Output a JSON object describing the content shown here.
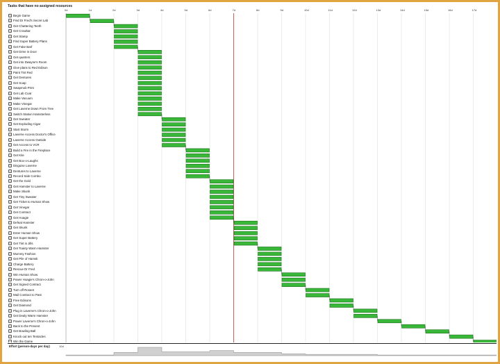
{
  "header": {
    "title": "Tasks that have no assigned resources"
  },
  "axis": {
    "day_labels": [
      "0d",
      "1d",
      "2d",
      "3d",
      "4d",
      "5d",
      "6d",
      "7d",
      "8d",
      "9d",
      "10d",
      "11d",
      "12d",
      "13d",
      "14d",
      "15d",
      "16d",
      "17d"
    ]
  },
  "effort": {
    "label": "Effort (person-days per day)",
    "max_label": "10d"
  },
  "colors": {
    "bar_fill": "#39b739",
    "bar_stroke": "#1c6f1c",
    "today_line": "#c0383c",
    "grid": "#d7e3d0",
    "frame": "#e0a440"
  },
  "today_day": 7,
  "tasks": [
    {
      "name": "Begin Game",
      "start": 0,
      "dur": 1
    },
    {
      "name": "Find Dr Fred's Secret Lab",
      "start": 1,
      "dur": 1
    },
    {
      "name": "Get Chattering Teeth",
      "start": 2,
      "dur": 1
    },
    {
      "name": "Get Crowbar",
      "start": 2,
      "dur": 1
    },
    {
      "name": "Get Stamp",
      "start": 2,
      "dur": 1
    },
    {
      "name": "Find Super Battery Plans",
      "start": 2,
      "dur": 1
    },
    {
      "name": "Get Fake Barf",
      "start": 2,
      "dur": 1
    },
    {
      "name": "Get Dime in Door",
      "start": 3,
      "dur": 1
    },
    {
      "name": "Get quarters",
      "start": 3,
      "dur": 1
    },
    {
      "name": "Get into Dwayne's Room",
      "start": 3,
      "dur": 1
    },
    {
      "name": "Give plans to Red Edison",
      "start": 3,
      "dur": 1
    },
    {
      "name": "Paint Tint Red",
      "start": 3,
      "dur": 1
    },
    {
      "name": "Get Dentures",
      "start": 3,
      "dur": 1
    },
    {
      "name": "Get Soap",
      "start": 3,
      "dur": 1
    },
    {
      "name": "Swapmob Print",
      "start": 3,
      "dur": 1
    },
    {
      "name": "Get Lab Coat",
      "start": 3,
      "dur": 1
    },
    {
      "name": "Make Vacuum",
      "start": 3,
      "dur": 1
    },
    {
      "name": "Make Vinegar",
      "start": 3,
      "dur": 1
    },
    {
      "name": "Get Laverne Down From Tree",
      "start": 3,
      "dur": 1
    },
    {
      "name": "Switch Station Hamsterless",
      "start": 3,
      "dur": 1
    },
    {
      "name": "Get Sweater",
      "start": 4,
      "dur": 1
    },
    {
      "name": "Get Exploding Cigar",
      "start": 4,
      "dur": 1
    },
    {
      "name": "Start Storm",
      "start": 4,
      "dur": 1
    },
    {
      "name": "Laverne Access Doctor's Office",
      "start": 4,
      "dur": 1
    },
    {
      "name": "Laverne Access Outside",
      "start": 4,
      "dur": 1
    },
    {
      "name": "Get Access to VCR",
      "start": 4,
      "dur": 1
    },
    {
      "name": "Build a Fire in the Fireplace",
      "start": 5,
      "dur": 1
    },
    {
      "name": "Get Kite",
      "start": 5,
      "dur": 1
    },
    {
      "name": "Get Box-o-Laughs",
      "start": 5,
      "dur": 1
    },
    {
      "name": "Disguise Laverne",
      "start": 5,
      "dur": 1
    },
    {
      "name": "Dentures to Laverne",
      "start": 5,
      "dur": 1
    },
    {
      "name": "Record Sale Combo",
      "start": 5,
      "dur": 1
    },
    {
      "name": "Get the Gold",
      "start": 6,
      "dur": 1
    },
    {
      "name": "Get Hamster to Laverne",
      "start": 6,
      "dur": 1
    },
    {
      "name": "Make Skunk",
      "start": 6,
      "dur": 1
    },
    {
      "name": "Get Tiny Sweater",
      "start": 6,
      "dur": 1
    },
    {
      "name": "Get Ticket to Human Show",
      "start": 6,
      "dur": 1
    },
    {
      "name": "Get Vinegar",
      "start": 6,
      "dur": 1
    },
    {
      "name": "Get Contract",
      "start": 6,
      "dur": 1
    },
    {
      "name": "Get Hoagie",
      "start": 6,
      "dur": 1
    },
    {
      "name": "Defeat Hamster",
      "start": 7,
      "dur": 1
    },
    {
      "name": "Get Skunk",
      "start": 7,
      "dur": 1
    },
    {
      "name": "Enter Human Show",
      "start": 7,
      "dur": 1
    },
    {
      "name": "Get Super Battery",
      "start": 7,
      "dur": 1
    },
    {
      "name": "Get Tint in Jills",
      "start": 7,
      "dur": 1
    },
    {
      "name": "Get Toasty Warm Hamster",
      "start": 8,
      "dur": 1
    },
    {
      "name": "Mummy Fashion",
      "start": 8,
      "dur": 1
    },
    {
      "name": "Get Pile of Hamsk",
      "start": 8,
      "dur": 1
    },
    {
      "name": "Charge Battery",
      "start": 8,
      "dur": 1
    },
    {
      "name": "Rescue Dr Fred",
      "start": 8,
      "dur": 1
    },
    {
      "name": "Win Human Show",
      "start": 9,
      "dur": 1
    },
    {
      "name": "Power Hoagie's Chron-o-John",
      "start": 9,
      "dur": 1
    },
    {
      "name": "Get Signed Contract",
      "start": 9,
      "dur": 1
    },
    {
      "name": "Turn off Roseet",
      "start": 10,
      "dur": 1
    },
    {
      "name": "Mail Contract to Past",
      "start": 10,
      "dur": 1
    },
    {
      "name": "Free Edisons",
      "start": 11,
      "dur": 1
    },
    {
      "name": "Get Diamond",
      "start": 11,
      "dur": 1
    },
    {
      "name": "Plug in Laverne's Chron-o-John",
      "start": 12,
      "dur": 1
    },
    {
      "name": "Get Dealy Warm Hamster",
      "start": 12,
      "dur": 1
    },
    {
      "name": "Power Laverne's Chron-o-John",
      "start": 13,
      "dur": 1
    },
    {
      "name": "Back to the Present",
      "start": 14,
      "dur": 1
    },
    {
      "name": "Get Bowling Ball",
      "start": 15,
      "dur": 1
    },
    {
      "name": "Knock out ten Tentacles",
      "start": 16,
      "dur": 1
    },
    {
      "name": "Win the Game",
      "start": 17,
      "dur": 1
    }
  ],
  "effort_series": {
    "days": [
      0,
      1,
      2,
      3,
      4,
      5,
      6,
      7,
      8,
      9,
      10,
      11,
      12,
      13,
      14,
      15,
      16,
      17
    ],
    "values": [
      1,
      1,
      5,
      13,
      6,
      6,
      8,
      5,
      5,
      3,
      2,
      2,
      2,
      1,
      1,
      1,
      1,
      1
    ]
  }
}
